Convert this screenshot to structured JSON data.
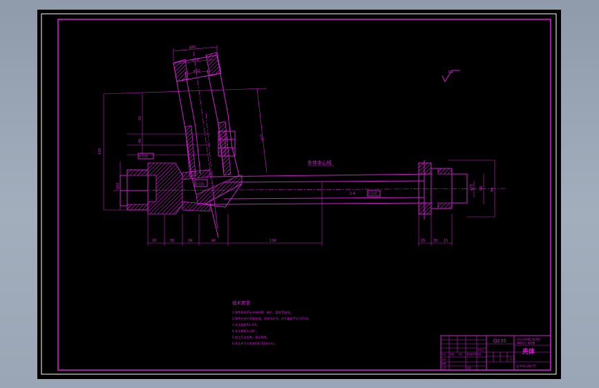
{
  "drawing": {
    "material": "Q235",
    "part_name": "壳体",
    "drawing_number": "JCTVG-ZB-TT",
    "centerline_label": "车体中心线",
    "tech_title": "技术要求",
    "tech_requirements": [
      "1.铸件表面不允许有砂眼、缩孔、裂纹等缺陷。",
      "2.铸件应进行时效处理，消除内应力，尺寸偏差不大于IT14。",
      "3.未注圆角R3~R5。",
      "4.未注倒角1×45°。",
      "5.加工后去毛刺，锐边倒钝。",
      "6.未注尺寸公差按GB/T1804-m。"
    ],
    "school_lines": [
      "XX大学机械工程学院",
      "课程设计 装配图"
    ],
    "scale": "1:1",
    "roughness": "3.2",
    "dims_bottom": [
      "26",
      "30",
      "24",
      "40",
      "134",
      "15",
      "30",
      "15"
    ],
    "dims_vertical": [
      "62",
      "40",
      "135",
      "102",
      "99",
      "98",
      "120"
    ],
    "dims_top": [
      "φ80",
      "φ56",
      "φ52"
    ],
    "small_labels": [
      "0.035",
      "0.035",
      "0.035",
      "2.4",
      "φ25",
      "φ40"
    ],
    "title_block_headers": [
      "标记",
      "处数",
      "分区",
      "更改文件号",
      "签名",
      "年月日"
    ],
    "title_block_rows": [
      "设计",
      "审核",
      "工艺",
      "批准"
    ]
  }
}
